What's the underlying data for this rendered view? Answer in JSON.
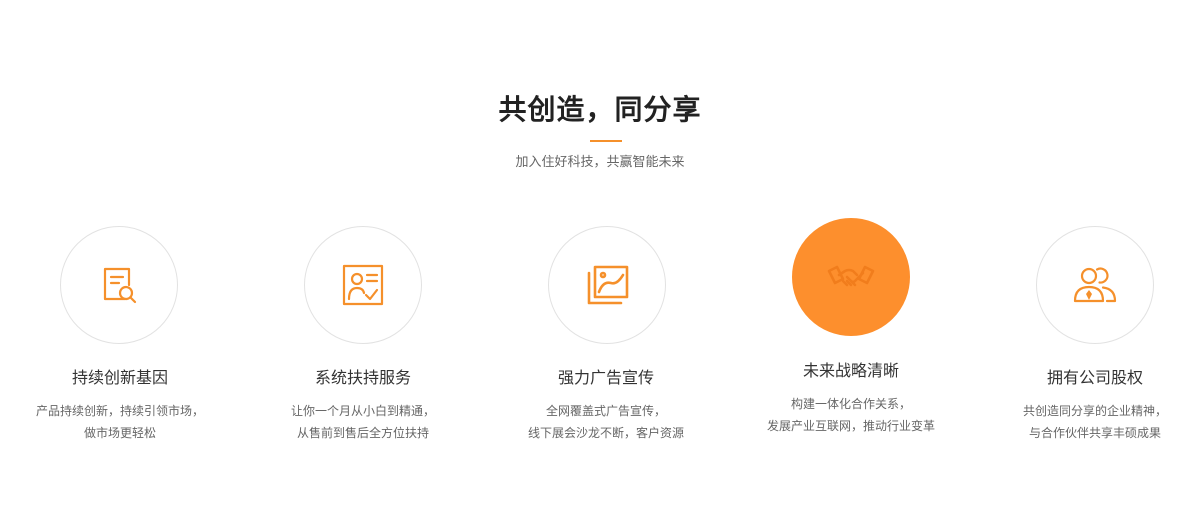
{
  "header": {
    "title": "共创造，同分享",
    "subtitle": "加入住好科技，共赢智能未来"
  },
  "accent_color": "#f5902b",
  "active_circle_color": "#fd8f2d",
  "features": [
    {
      "icon": "document-search-icon",
      "title": "持续创新基因",
      "desc_line1": "产品持续创新，持续引领市场，",
      "desc_line2": "做市场更轻松"
    },
    {
      "icon": "person-certificate-icon",
      "title": "系统扶持服务",
      "desc_line1": "让你一个月从小白到精通，",
      "desc_line2": "从售前到售后全方位扶持"
    },
    {
      "icon": "ad-frame-icon",
      "title": "强力广告宣传",
      "desc_line1": "全网覆盖式广告宣传，",
      "desc_line2": "线下展会沙龙不断，客户资源"
    },
    {
      "icon": "handshake-icon",
      "title": "未来战略清晰",
      "desc_line1": "构建一体化合作关系，",
      "desc_line2": "发展产业互联网，推动行业变革"
    },
    {
      "icon": "people-equity-icon",
      "title": "拥有公司股权",
      "desc_line1": "共创造同分享的企业精神，",
      "desc_line2": "与合作伙伴共享丰硕成果"
    }
  ]
}
